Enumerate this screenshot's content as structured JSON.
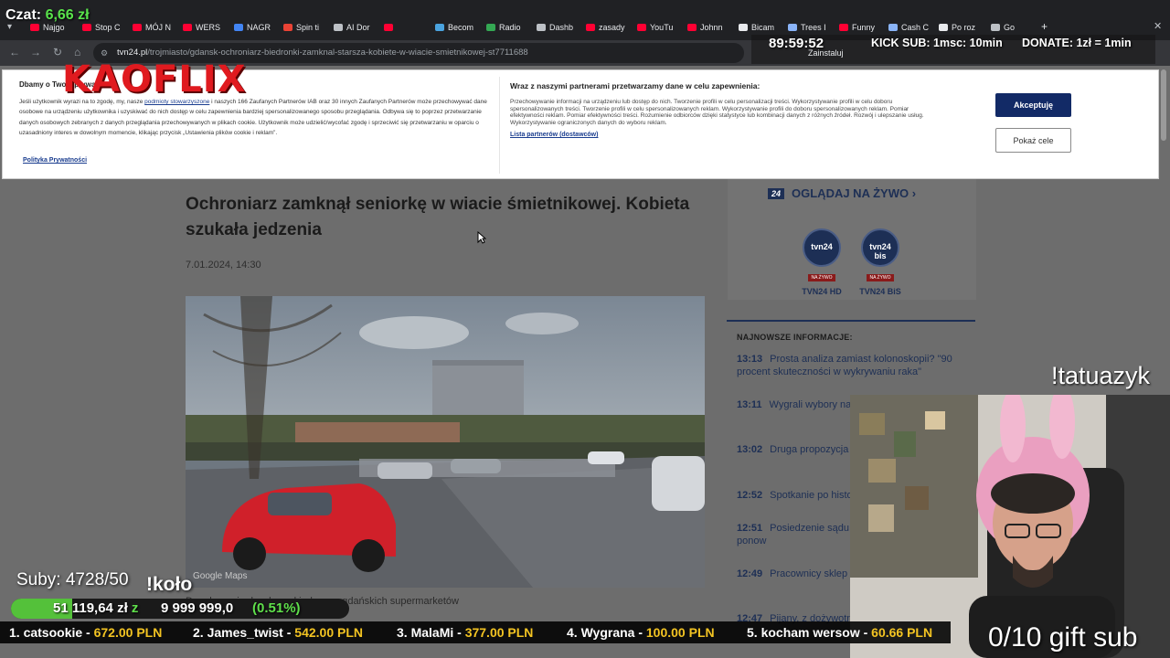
{
  "browser": {
    "tabs": [
      {
        "label": "Najgo",
        "color": "#ff0033"
      },
      {
        "label": "Stop C",
        "color": "#ff0033"
      },
      {
        "label": "MÓJ N",
        "color": "#ff0033"
      },
      {
        "label": "WERS",
        "color": "#ff0033"
      },
      {
        "label": "NAGR",
        "color": "#4285f4"
      },
      {
        "label": "Spin ti",
        "color": "#ea4335"
      },
      {
        "label": "AI Dor",
        "color": "#bdc1c6"
      },
      {
        "label": "",
        "color": "#ff0033"
      },
      {
        "label": "Becom",
        "color": "#4aa3df"
      },
      {
        "label": "Radio",
        "color": "#34a853"
      },
      {
        "label": "Dashb",
        "color": "#bdc1c6"
      },
      {
        "label": "zasady",
        "color": "#ff0033"
      },
      {
        "label": "YouTu",
        "color": "#ff0033"
      },
      {
        "label": "Johnn",
        "color": "#ff0033"
      },
      {
        "label": "Bicam",
        "color": "#e8eaed"
      },
      {
        "label": "Trees I",
        "color": "#8ab4f8"
      },
      {
        "label": "Funny",
        "color": "#ff0033"
      },
      {
        "label": "Cash C",
        "color": "#8ab4f8"
      },
      {
        "label": "Po roz",
        "color": "#e8eaed"
      },
      {
        "label": "Go",
        "color": "#bdc1c6"
      }
    ],
    "url_host": "tvn24.pl",
    "url_path": "/trojmiasto/gdansk-ochroniarz-biedronki-zamknal-starsza-kobiete-w-wiacie-smietnikowej-st7711688",
    "install_label": "Zainstaluj"
  },
  "consent": {
    "title": "Dbamy o Twoją prywatność",
    "text_before_link": "Jeśli użytkownik wyrazi na to zgodę, my, nasze ",
    "link_text": "podmioty stowarzyszone",
    "text_after_link": " i naszych 166 Zaufanych Partnerów IAB oraz 30 innych Zaufanych Partnerów może przechowywać dane osobowe na urządzeniu użytkownika i uzyskiwać do nich dostęp w celu zapewnienia bardziej spersonalizowanego sposobu przeglądania. Odbywa się to poprzez przetwarzanie danych osobowych zebranych z danych przeglądania przechowywanych w plikach cookie. Użytkownik może udzielić/wycofać zgodę i sprzeciwić się przetwarzaniu w oparciu o uzasadniony interes w dowolnym momencie, klikając przycisk „Ustawienia plików cookie i reklam”.",
    "policy_link": "Polityka Prywatności",
    "title2": "Wraz z naszymi partnerami przetwarzamy dane w celu zapewnienia:",
    "text2": "Przechowywanie informacji na urządzeniu lub dostęp do nich. Tworzenie profili w celu personalizacji treści. Wykorzystywanie profili w celu doboru spersonalizowanych treści. Tworzenie profili w celu spersonalizowanych reklam. Wykorzystywanie profili do doboru spersonalizowanych reklam. Pomiar efektywności reklam. Pomiar efektywności treści. Rozumienie odbiorców dzięki statystyce lub kombinacji danych z różnych źródeł. Rozwój i ulepszanie usług. Wykorzystywanie ograniczonych danych do wyboru reklam.",
    "partners_link": "Lista partnerów (dostawców)",
    "accept_label": "Akceptuję",
    "more_label": "Pokaż cele"
  },
  "article": {
    "title": "Ochroniarz zamknął seniorkę w wiacie śmietnikowej. Kobieta szukała jedzenia",
    "date": "7.01.2024, 14:30",
    "photo_watermark": "Google Maps",
    "caption": "Do zdarzenia doszło pod jednym z gdańskich supermarketów"
  },
  "sidebar": {
    "live_badge": "24",
    "live_label": "OGLĄDAJ NA ŻYWO ›",
    "channels": [
      {
        "logo": "tvn24",
        "live": "NA ŻYWO",
        "name": "TVN24 HD"
      },
      {
        "logo": "tvn24 bis",
        "live": "NA ŻYWO",
        "name": "TVN24 BiS"
      }
    ],
    "news_heading": "NAJNOWSZE INFORMACJE:",
    "news": [
      {
        "time": "13:13",
        "title": "Prosta analiza zamiast kolonoskopii? \"90 procent skuteczności w wykrywaniu raka\""
      },
      {
        "time": "13:11",
        "title": "Wygrali wybory na Kalendarium"
      },
      {
        "time": "13:02",
        "title": "Druga propozycja obniżenie cen paliw"
      },
      {
        "time": "12:52",
        "title": "Spotkanie po histo"
      },
      {
        "time": "12:51",
        "title": "Posiedzenie sądu byłego szefa RARS ponow"
      },
      {
        "time": "12:49",
        "title": "Pracownicy sklep strajk. \"Są przeciążani do"
      },
      {
        "time": "12:47",
        "title": "Pijany, z dożywotn po"
      }
    ]
  },
  "overlay": {
    "chat_label": "Czat:",
    "chat_amount": "6,66 zł",
    "brand": "KAOFLIX",
    "timer": "89:59:52",
    "kick_sub": "KICK SUB: 1msc: 10min",
    "donate": "DONATE: 1zł = 1min",
    "tatuazyk": "!tatuazyk",
    "subs": "Suby: 4728/50",
    "kolo": "!koło",
    "goal_amount": "51 119,64 zł",
    "goal_z": "z",
    "goal_target": "9 999 999,0",
    "goal_percent_label": "(0.51%)",
    "goal_fraction": 0.0051,
    "gift_sub": "0/10 gift sub",
    "ticker": [
      {
        "name": "1. catsookie",
        "amount": "672.00 PLN"
      },
      {
        "name": "2. James_twist",
        "amount": "542.00 PLN"
      },
      {
        "name": "3. MalaMi",
        "amount": "377.00 PLN"
      },
      {
        "name": "4. Wygrana",
        "amount": "100.00 PLN"
      },
      {
        "name": "5. kocham wersow",
        "amount": "60.66 PLN"
      }
    ]
  }
}
